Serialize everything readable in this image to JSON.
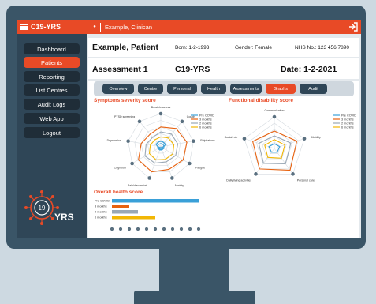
{
  "app": {
    "title": "C19-YRS",
    "logo_text": "YRS",
    "logo_number": "19"
  },
  "user": {
    "name": "Example, Clinican"
  },
  "nav": [
    {
      "label": "Dashboard",
      "active": false
    },
    {
      "label": "Patients",
      "active": true
    },
    {
      "label": "Reporting",
      "active": false
    },
    {
      "label": "List Centres",
      "active": false
    },
    {
      "label": "Audit Logs",
      "active": false
    },
    {
      "label": "Web App",
      "active": false
    },
    {
      "label": "Logout",
      "active": false
    }
  ],
  "patient": {
    "name": "Example, Patient",
    "born": "Born: 1-2-1993",
    "gender": "Gender: Female",
    "nhs": "NHS No.: 123 456 7890"
  },
  "assessment": {
    "label": "Assessment 1",
    "scale": "C19-YRS",
    "date": "Date: 1-2-2021"
  },
  "tabs": [
    {
      "label": "Overview",
      "active": false
    },
    {
      "label": "Centre",
      "active": false
    },
    {
      "label": "Personal",
      "active": false
    },
    {
      "label": "Health",
      "active": false
    },
    {
      "label": "Assessments",
      "active": false
    },
    {
      "label": "Graphs",
      "active": true
    },
    {
      "label": "Audit",
      "active": false
    }
  ],
  "colors": {
    "accent": "#e84a26",
    "sidebar": "#2f4657",
    "pre": "#3aa0d8",
    "m3": "#e8620f",
    "m2": "#9aa8b5",
    "m6": "#f2b705"
  },
  "chart_data": [
    {
      "type": "radar",
      "title": "Symptoms severity score",
      "axes": [
        "Breathlessness",
        "Cough",
        "Palpitations",
        "Fatigue",
        "Anxiety",
        "Pain/discomfort",
        "Cognition",
        "Depression",
        "PTSD screening"
      ],
      "series": [
        {
          "name": "Pre COVID",
          "values": [
            0.1,
            0.1,
            0.1,
            0.1,
            0.1,
            0.1,
            0.1,
            0.1,
            0.1
          ]
        },
        {
          "name": "3 months",
          "values": [
            0.6,
            0.72,
            0.8,
            0.78,
            0.72,
            0.8,
            0.78,
            0.6,
            0.5
          ]
        },
        {
          "name": "2 months",
          "values": [
            0.45,
            0.5,
            0.52,
            0.52,
            0.48,
            0.52,
            0.55,
            0.45,
            0.38
          ]
        },
        {
          "name": "6 months",
          "values": [
            0.3,
            0.35,
            0.4,
            0.42,
            0.4,
            0.42,
            0.4,
            0.32,
            0.28
          ]
        }
      ]
    },
    {
      "type": "radar",
      "title": "Functional disability score",
      "axes": [
        "Communication",
        "Mobility",
        "Personal care",
        "Daily living activities",
        "Social role"
      ],
      "series": [
        {
          "name": "Pre COVID",
          "values": [
            0.15,
            0.18,
            0.15,
            0.15,
            0.18
          ]
        },
        {
          "name": "3 months",
          "values": [
            0.55,
            0.75,
            0.85,
            0.8,
            0.72
          ]
        },
        {
          "name": "2 months",
          "values": [
            0.4,
            0.55,
            0.6,
            0.58,
            0.52
          ]
        },
        {
          "name": "6 months",
          "values": [
            0.28,
            0.35,
            0.38,
            0.35,
            0.32
          ]
        }
      ]
    },
    {
      "type": "bar",
      "orientation": "horizontal",
      "title": "Overall health score",
      "categories": [
        "Pre COVID",
        "3 months",
        "2 months",
        "6 months"
      ],
      "values": [
        10,
        2,
        3,
        5
      ],
      "xlim": [
        0,
        10
      ]
    }
  ]
}
